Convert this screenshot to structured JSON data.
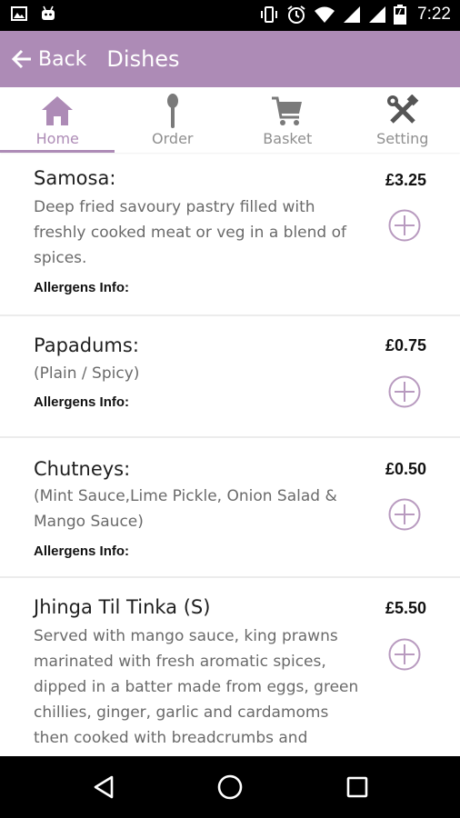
{
  "status_bar": {
    "time": "7:22",
    "left_icons": [
      "image-icon",
      "android-icon"
    ],
    "right_icons": [
      "vibrate-icon",
      "alarm-icon",
      "wifi-icon",
      "signal-icon",
      "signal-icon",
      "battery-icon"
    ]
  },
  "app_bar": {
    "back_label": "Back",
    "title": "Dishes",
    "color": "#ad8bb6"
  },
  "tabs": [
    {
      "label": "Home",
      "icon": "home-icon",
      "active": true
    },
    {
      "label": "Order",
      "icon": "spoon-icon",
      "active": false
    },
    {
      "label": "Basket",
      "icon": "cart-icon",
      "active": false
    },
    {
      "label": "Setting",
      "icon": "tools-icon",
      "active": false
    }
  ],
  "dishes": [
    {
      "name": "Samosa:",
      "description_lines": [
        "Deep fried savoury pastry filled with",
        "freshly cooked meat or veg in a blend of",
        "spices."
      ],
      "allergens": "Allergens Info:",
      "price": "£3.25"
    },
    {
      "name": "Papadums:",
      "description_lines": [
        "(Plain / Spicy)"
      ],
      "allergens": "Allergens Info:",
      "price": "£0.75"
    },
    {
      "name": "Chutneys:",
      "description_lines": [
        "(Mint Sauce,Lime Pickle, Onion Salad &",
        "Mango Sauce)"
      ],
      "allergens": "Allergens Info:",
      "price": "£0.50"
    },
    {
      "name": "Jhinga Til Tinka (S)",
      "description_lines": [
        "Served with mango sauce, king prawns",
        "marinated with fresh aromatic spices,",
        "dipped in a batter made from eggs, green",
        "chillies, ginger, garlic and cardamoms",
        "then cooked with breadcrumbs and"
      ],
      "allergens": "",
      "price": "£5.50"
    }
  ],
  "nav_bar": {
    "buttons": [
      "back-triangle-icon",
      "home-circle-icon",
      "recents-square-icon"
    ]
  }
}
